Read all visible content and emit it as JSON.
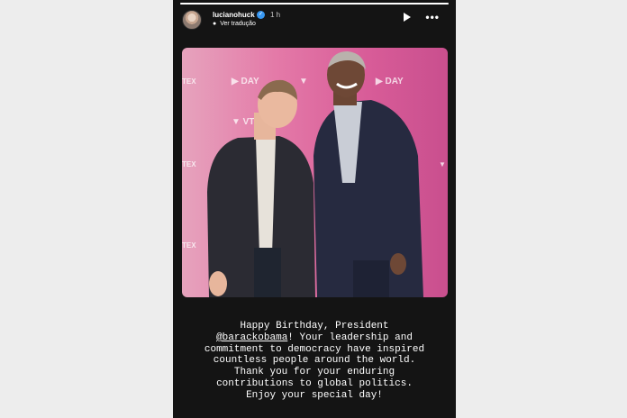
{
  "header": {
    "username": "lucianohuck",
    "time": "1 h",
    "translate_label": "Ver tradução",
    "progress": 1.0
  },
  "icons": {
    "verified": "verified-badge-icon",
    "globe": "globe-icon",
    "play": "play-icon",
    "more": "more-options-icon"
  },
  "photo": {
    "backdrop_brand": "VTEX DAY",
    "backdrop_color": "#e0629f"
  },
  "caption": {
    "line1": "Happy Birthday, President",
    "mention": "@barackobama",
    "line2_rest": "! Your leadership and",
    "line3": "commitment to democracy have inspired",
    "line4": "countless people around the world.",
    "line5": "Thank you for your enduring",
    "line6": "contributions to global politics.",
    "line7": "Enjoy your special day!"
  }
}
